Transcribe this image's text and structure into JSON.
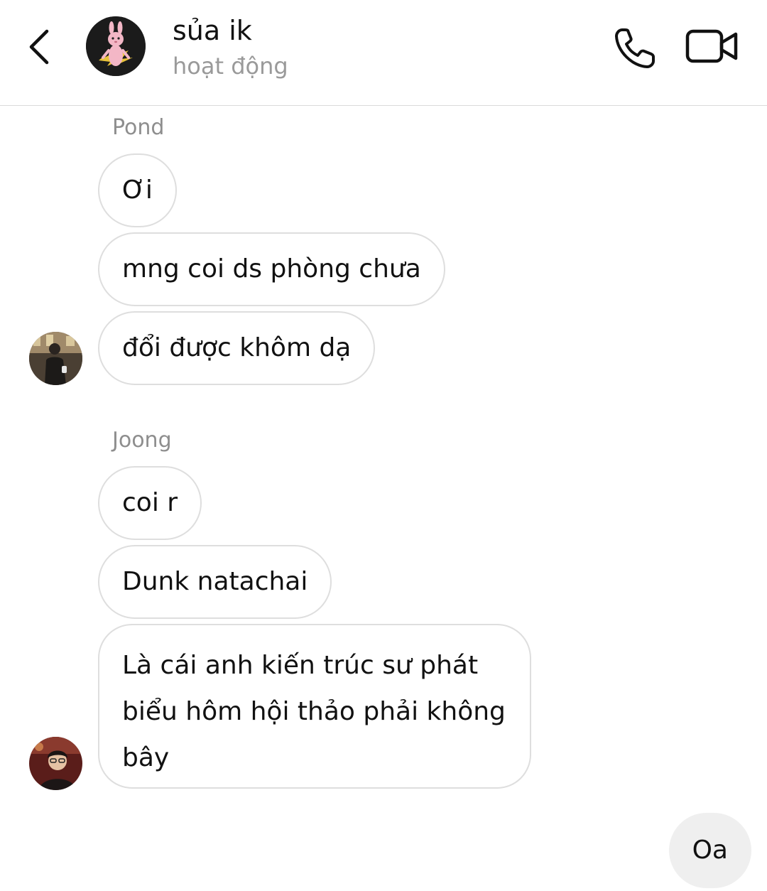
{
  "header": {
    "title": "sủa ik",
    "status": "hoạt động"
  },
  "messages": {
    "group1": {
      "sender": "Pond",
      "bubbles": [
        "Ơi",
        "mng coi ds phòng chưa",
        "đổi được khôm dạ"
      ]
    },
    "group2": {
      "sender": "Joong",
      "bubbles": [
        "coi r",
        "Dunk natachai",
        "Là cái anh kiến trúc sư phát biểu hôm hội thảo phải không bây"
      ]
    },
    "mine": {
      "text": "Oa"
    }
  },
  "colors": {
    "bubble_border": "#dedede",
    "own_bubble_bg": "#efefef",
    "muted_text": "#8e8e8e"
  },
  "icons": {
    "back": "chevron-left-icon",
    "call": "phone-icon",
    "video": "video-camera-icon"
  }
}
